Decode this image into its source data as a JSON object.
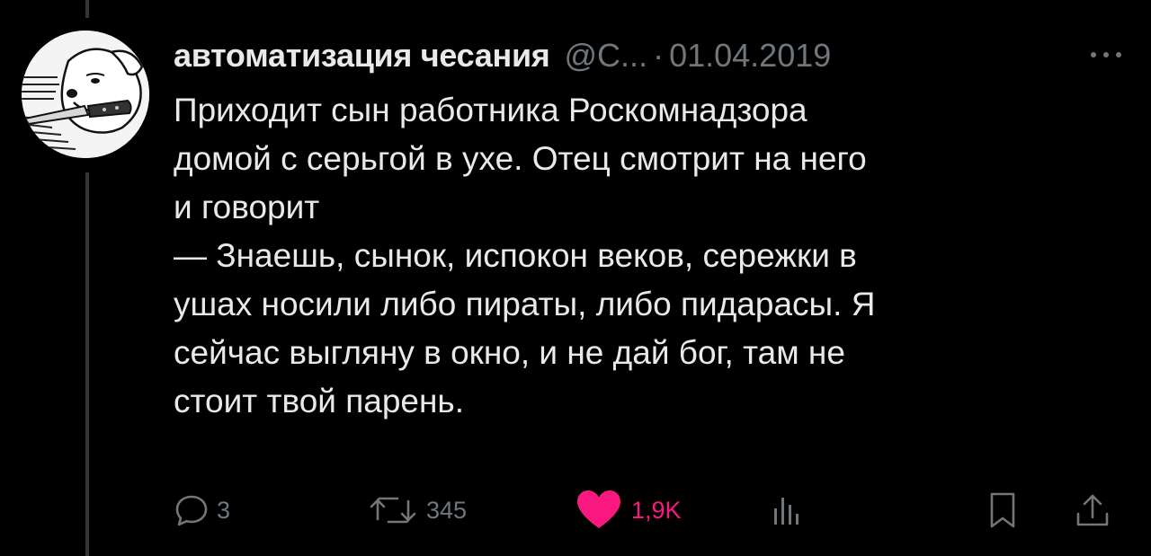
{
  "tweet": {
    "author": {
      "display_name": "автоматизация чесания",
      "handle": "@C...",
      "avatar_icon": "dog-with-knife-avatar"
    },
    "separator": "·",
    "date": "01.04.2019",
    "more_icon": "more-dots-icon",
    "text": "Приходит сын работника Роскомнадзора\nдомой с серьгой в ухе. Отец смотрит на него\nи говорит\n— Знаешь, сынок, испокон веков, сережки в\nушах носили либо пираты, либо пидарасы. Я\nсейчас выгляну в окно, и не дай бог, там не\nстоит твой парень."
  },
  "actions": {
    "reply": {
      "icon": "reply-icon",
      "count": "3"
    },
    "retweet": {
      "icon": "retweet-icon",
      "count": "345"
    },
    "like": {
      "icon": "heart-icon",
      "count": "1,9K",
      "liked": true
    },
    "views": {
      "icon": "views-icon"
    },
    "bookmark": {
      "icon": "bookmark-icon"
    },
    "share": {
      "icon": "share-icon"
    }
  },
  "colors": {
    "background": "#000000",
    "text_primary": "#e7e9ea",
    "text_secondary": "#71767b",
    "like_accent": "#f91880",
    "thread_line": "#333639"
  }
}
